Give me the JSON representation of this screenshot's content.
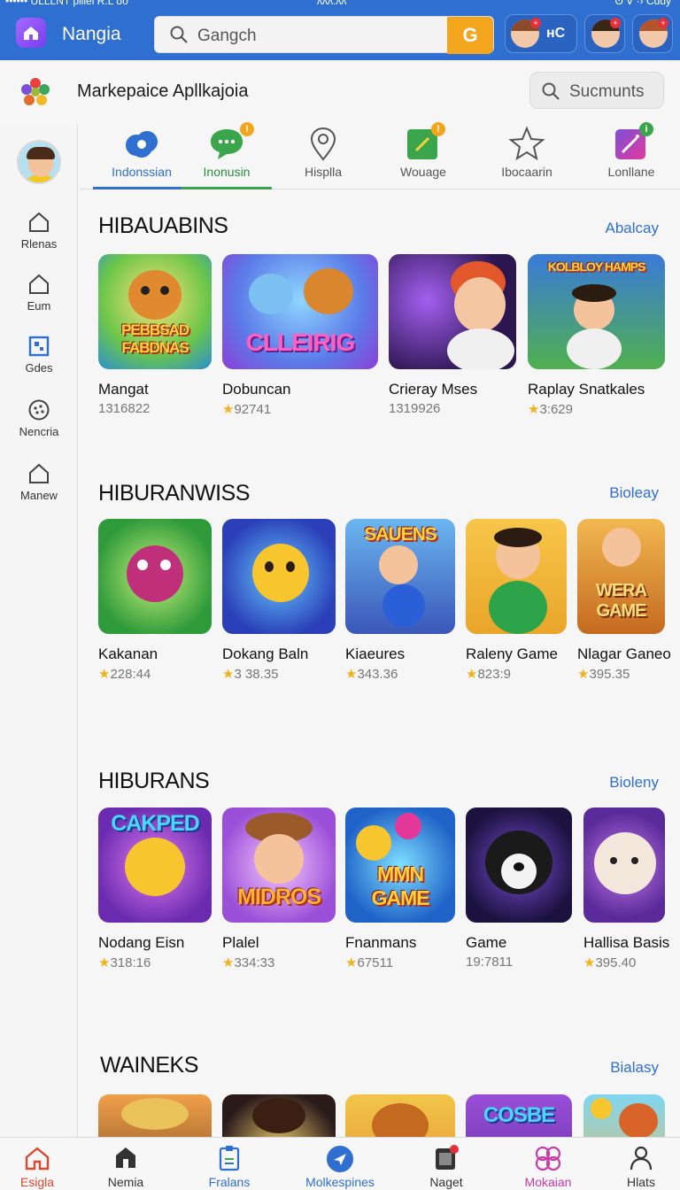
{
  "statusbar": {
    "left": "•••••• ULLLNT pillel R.L   ʊo",
    "center": "ʌʌʌ:ʌʌ",
    "right": "ʘ ᐁ ·› Cɑɑy"
  },
  "topbar": {
    "app_name": "Nangia",
    "search_value": "Gangch",
    "search_go": "G",
    "account_text": "ʜC",
    "colors": {
      "bar": "#2f6fd0",
      "go": "#f2a51d"
    }
  },
  "marketplace": {
    "title": "Markepaice Apllkajoia",
    "search_button": "Sucmunts"
  },
  "rail": {
    "items": [
      {
        "label": "Rlenas",
        "icon": "home-outline-icon"
      },
      {
        "label": "Eum",
        "icon": "home-outline-icon"
      },
      {
        "label": "Gdes",
        "icon": "grid-square-icon"
      },
      {
        "label": "Nencria",
        "icon": "dots-circle-icon"
      },
      {
        "label": "Manew",
        "icon": "home-outline-icon"
      }
    ]
  },
  "tabs": [
    {
      "label": "Indonssian",
      "icon": "gear-cloud-icon",
      "color": "#2f6fd0"
    },
    {
      "label": "Inonusin",
      "icon": "chat-bubble-icon",
      "color": "#2a8f3a"
    },
    {
      "label": "Hisplla",
      "icon": "map-pin-icon",
      "color": "#555555"
    },
    {
      "label": "Wouage",
      "icon": "edit-square-icon",
      "color": "#555555"
    },
    {
      "label": "Ibocaarin",
      "icon": "star-outline-icon",
      "color": "#555555"
    },
    {
      "label": "Lonllane",
      "icon": "magic-wand-icon",
      "color": "#c83aa7"
    }
  ],
  "sections": [
    {
      "title": "HIBAUABINS",
      "more": "Abalcay",
      "items": [
        {
          "name": "Mangat",
          "meta": "1316822",
          "star": false,
          "art": "PEBBSAD FABDNAS"
        },
        {
          "name": "Dobuncan",
          "meta": "92741",
          "star": true,
          "art": "CLLEIRIG"
        },
        {
          "name": "Crieray Mses",
          "meta": "1319926",
          "star": false,
          "art": ""
        },
        {
          "name": "Raplay Snatkales",
          "meta": "3:629",
          "star": true,
          "art": "KOLBLOY HAMPS"
        }
      ]
    },
    {
      "title": "HIBURANWISS",
      "more": "Bioleay",
      "items": [
        {
          "name": "Kakanan",
          "meta": "228:44",
          "star": true,
          "art": ""
        },
        {
          "name": "Dokang Baln",
          "meta": "3 38.35",
          "star": true,
          "art": ""
        },
        {
          "name": "Kiaeures",
          "meta": "343.36",
          "star": true,
          "art": "SAUENS"
        },
        {
          "name": "Raleny Game",
          "meta": "823:9",
          "star": true,
          "art": ""
        },
        {
          "name": "Nlagar Ganeo",
          "meta": "395.35",
          "star": true,
          "art": "WERA GAME"
        }
      ]
    },
    {
      "title": "HIBURANS",
      "more": "Bioleny",
      "items": [
        {
          "name": "Nodang Eisn",
          "meta": "318:16",
          "star": true,
          "art": "CAKPED"
        },
        {
          "name": "Plalel",
          "meta": "334:33",
          "star": true,
          "art": "MIDROS"
        },
        {
          "name": "Fnanmans",
          "meta": "67511",
          "star": true,
          "art": "MMN GAME"
        },
        {
          "name": "Game",
          "meta": "19:7811",
          "star": false,
          "art": ""
        },
        {
          "name": "Ηallisa Basis",
          "meta": "395.40",
          "star": true,
          "art": ""
        }
      ]
    },
    {
      "title": "WAINEKS",
      "more": "Bialasy",
      "items": [
        {
          "name": "",
          "meta": "",
          "star": false,
          "art": ""
        },
        {
          "name": "",
          "meta": "",
          "star": false,
          "art": ""
        },
        {
          "name": "",
          "meta": "",
          "star": false,
          "art": ""
        },
        {
          "name": "",
          "meta": "",
          "star": false,
          "art": "COSBE"
        },
        {
          "name": "",
          "meta": "",
          "star": false,
          "art": ""
        }
      ]
    }
  ],
  "bottomnav": [
    {
      "label": "Esigla",
      "icon": "home-icon",
      "color": "#e0472f"
    },
    {
      "label": "Nemia",
      "icon": "house-filled-icon",
      "color": "#333333"
    },
    {
      "label": "Fralans",
      "icon": "clipboard-icon",
      "color": "#2f6fd0"
    },
    {
      "label": "Molkespines",
      "icon": "send-circle-icon",
      "color": "#2f6fd0"
    },
    {
      "label": "Naget",
      "icon": "tablet-icon",
      "color": "#333333"
    },
    {
      "label": "Mokaian",
      "icon": "molecule-icon",
      "color": "#c83aa7"
    },
    {
      "label": "Hlats",
      "icon": "person-icon",
      "color": "#333333"
    }
  ]
}
